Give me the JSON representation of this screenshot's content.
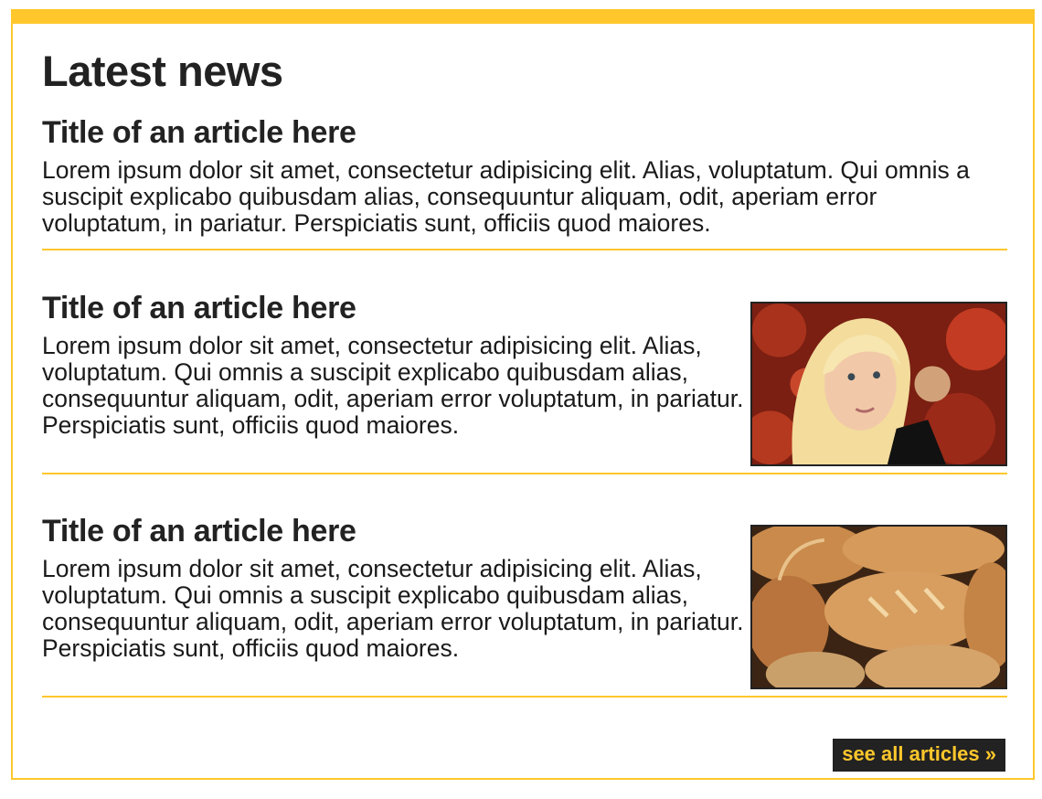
{
  "section": {
    "heading": "Latest news",
    "accent_color": "#ffc72c"
  },
  "articles": [
    {
      "title": "Title of an article here",
      "body": "Lorem ipsum dolor sit amet, consectetur adipisicing elit. Alias, voluptatum. Qui omnis a suscipit explicabo quibusdam alias, consequuntur aliquam, odit, aperiam error voluptatum, in pariatur. Perspiciatis sunt, officiis quod maiores.",
      "image": null
    },
    {
      "title": "Title of an article here",
      "body": "Lorem ipsum dolor sit amet, consectetur adipisicing elit. Alias, voluptatum. Qui omnis a suscipit explicabo quibusdam alias, consequuntur aliquam, odit, aperiam error voluptatum, in pariatur. Perspiciatis sunt, officiis quod maiores.",
      "image": "blonde-woman-photo"
    },
    {
      "title": "Title of an article here",
      "body": "Lorem ipsum dolor sit amet, consectetur adipisicing elit. Alias, voluptatum. Qui omnis a suscipit explicabo quibusdam alias, consequuntur aliquam, odit, aperiam error voluptatum, in pariatur. Perspiciatis sunt, officiis quod maiores.",
      "image": "bread-loaves-photo"
    }
  ],
  "footer": {
    "see_all_label": "see all articles »"
  }
}
